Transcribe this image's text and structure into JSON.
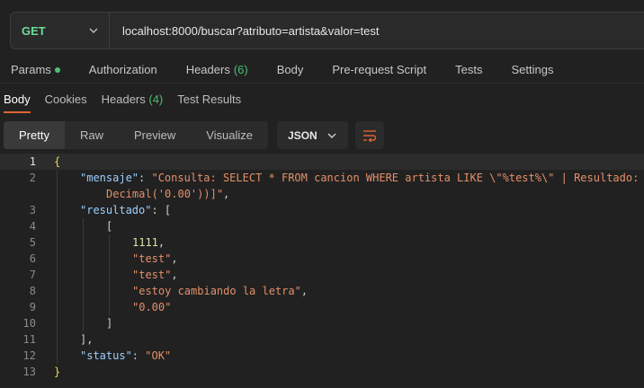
{
  "request": {
    "method": "GET",
    "url": "localhost:8000/buscar?atributo=artista&valor=test"
  },
  "request_tabs": [
    {
      "label": "Params",
      "dot": true
    },
    {
      "label": "Authorization"
    },
    {
      "label": "Headers",
      "count": "(6)"
    },
    {
      "label": "Body"
    },
    {
      "label": "Pre-request Script"
    },
    {
      "label": "Tests"
    },
    {
      "label": "Settings"
    }
  ],
  "response_tabs": [
    {
      "label": "Body",
      "active": true
    },
    {
      "label": "Cookies"
    },
    {
      "label": "Headers",
      "count": "(4)"
    },
    {
      "label": "Test Results"
    }
  ],
  "view_modes": [
    "Pretty",
    "Raw",
    "Preview",
    "Visualize"
  ],
  "active_view": "Pretty",
  "format": "JSON",
  "code_lines": [
    {
      "n": "1",
      "indent": 0,
      "tokens": [
        [
          "bracket-y",
          "{"
        ]
      ]
    },
    {
      "n": "2",
      "indent": 1,
      "tokens": [
        [
          "k",
          "\"mensaje\""
        ],
        [
          "p",
          ": "
        ],
        [
          "s",
          "\"Consulta: SELECT * FROM cancion WHERE artista LIKE \\\"%test%\\\" | Resultado:"
        ]
      ]
    },
    {
      "n": "",
      "indent": 2,
      "tokens": [
        [
          "s",
          "Decimal('0.00'))]\""
        ],
        [
          "p",
          ","
        ]
      ]
    },
    {
      "n": "3",
      "indent": 1,
      "tokens": [
        [
          "k",
          "\"resultado\""
        ],
        [
          "p",
          ": ["
        ]
      ]
    },
    {
      "n": "4",
      "indent": 2,
      "tokens": [
        [
          "p",
          "["
        ]
      ]
    },
    {
      "n": "5",
      "indent": 3,
      "tokens": [
        [
          "n",
          "1111"
        ],
        [
          "p",
          ","
        ]
      ]
    },
    {
      "n": "6",
      "indent": 3,
      "tokens": [
        [
          "s",
          "\"test\""
        ],
        [
          "p",
          ","
        ]
      ]
    },
    {
      "n": "7",
      "indent": 3,
      "tokens": [
        [
          "s",
          "\"test\""
        ],
        [
          "p",
          ","
        ]
      ]
    },
    {
      "n": "8",
      "indent": 3,
      "tokens": [
        [
          "s",
          "\"estoy cambiando la letra\""
        ],
        [
          "p",
          ","
        ]
      ]
    },
    {
      "n": "9",
      "indent": 3,
      "tokens": [
        [
          "s",
          "\"0.00\""
        ]
      ]
    },
    {
      "n": "10",
      "indent": 2,
      "tokens": [
        [
          "p",
          "]"
        ]
      ]
    },
    {
      "n": "11",
      "indent": 1,
      "tokens": [
        [
          "p",
          "],"
        ]
      ]
    },
    {
      "n": "12",
      "indent": 1,
      "tokens": [
        [
          "k",
          "\"status\""
        ],
        [
          "p",
          ": "
        ],
        [
          "s",
          "\"OK\""
        ]
      ]
    },
    {
      "n": "13",
      "indent": 0,
      "tokens": [
        [
          "bracket-y",
          "}"
        ]
      ]
    }
  ],
  "colors": {
    "method": "#6bdd9a",
    "accent": "#e0632f",
    "count": "#4fbf73",
    "json_key": "#9ccfff",
    "json_string": "#e48f68"
  }
}
